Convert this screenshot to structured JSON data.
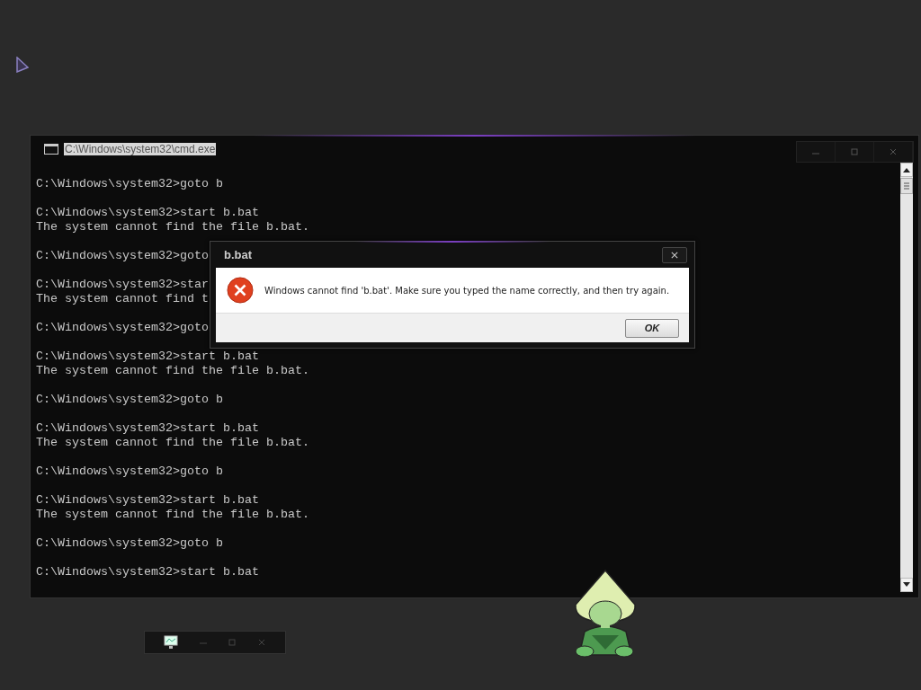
{
  "console_window": {
    "title": "C:\\Windows\\system32\\cmd.exe",
    "title_selected": true,
    "blocks": [
      [
        "C:\\Windows\\system32>goto b"
      ],
      [
        "C:\\Windows\\system32>start b.bat",
        "The system cannot find the file b.bat."
      ],
      [
        "C:\\Windows\\system32>goto"
      ],
      [
        "C:\\Windows\\system32>star",
        "The system cannot find t"
      ],
      [
        "C:\\Windows\\system32>goto"
      ],
      [
        "C:\\Windows\\system32>start b.bat",
        "The system cannot find the file b.bat."
      ],
      [
        "C:\\Windows\\system32>goto b"
      ],
      [
        "C:\\Windows\\system32>start b.bat",
        "The system cannot find the file b.bat."
      ],
      [
        "C:\\Windows\\system32>goto b"
      ],
      [
        "C:\\Windows\\system32>start b.bat",
        "The system cannot find the file b.bat."
      ],
      [
        "C:\\Windows\\system32>goto b"
      ],
      [
        "C:\\Windows\\system32>start b.bat"
      ]
    ]
  },
  "dialog": {
    "title": "b.bat",
    "message": "Windows cannot find 'b.bat'. Make sure you typed the name correctly, and then try again.",
    "buttons": [
      "OK"
    ]
  }
}
